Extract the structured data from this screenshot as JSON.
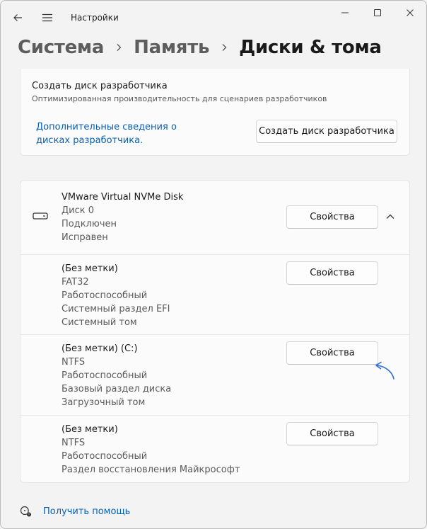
{
  "window": {
    "title": "Настройки"
  },
  "breadcrumb": [
    "Система",
    "Память",
    "Диски & тома"
  ],
  "dev_drive": {
    "title": "Создать диск разработчика",
    "subtitle": "Оптимизированная производительность для сценариев разработчиков",
    "link": "Дополнительные сведения о дисках разработчика.",
    "button": "Создать диск разработчика"
  },
  "disk": {
    "name": "VMware Virtual NVMe Disk",
    "lines": [
      "Диск 0",
      "Подключен",
      "Исправен"
    ],
    "button": "Свойства",
    "volumes": [
      {
        "title": "(Без метки)",
        "lines": [
          "FAT32",
          "Работоспособный",
          "Системный раздел EFI",
          "Системный том"
        ],
        "button": "Свойства"
      },
      {
        "title": "(Без метки) (C:)",
        "lines": [
          "NTFS",
          "Работоспособный",
          "Базовый раздел диска",
          "Загрузочный том"
        ],
        "button": "Свойства"
      },
      {
        "title": "(Без метки)",
        "lines": [
          "NTFS",
          "Работоспособный",
          "Раздел восстановления Майкрософт"
        ],
        "button": "Свойства"
      }
    ]
  },
  "help": {
    "label": "Получить помощь"
  },
  "colors": {
    "accent": "#0a5fb0",
    "arrow": "#2a6fd6"
  }
}
